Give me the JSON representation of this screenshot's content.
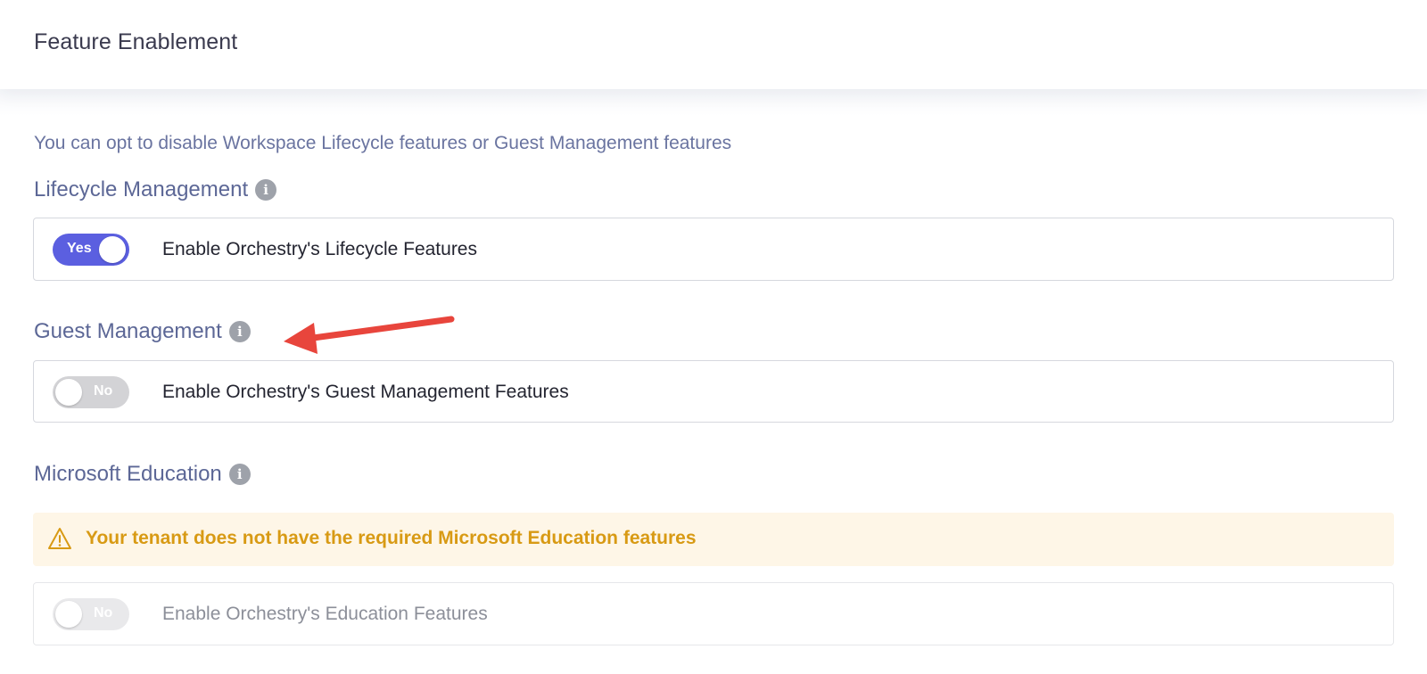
{
  "header": {
    "title": "Feature Enablement"
  },
  "intro_text": "You can opt to disable Workspace Lifecycle features or Guest Management features",
  "sections": [
    {
      "title": "Lifecycle Management",
      "icon": "info-icon",
      "toggle": {
        "state": "Yes",
        "enabled": true
      },
      "label": "Enable Orchestry's Lifecycle Features"
    },
    {
      "title": "Guest Management",
      "icon": "info-icon",
      "toggle": {
        "state": "No",
        "enabled": false
      },
      "label": "Enable Orchestry's Guest Management Features"
    },
    {
      "title": "Microsoft Education",
      "icon": "info-icon",
      "warning": {
        "icon": "warning-triangle-icon",
        "text": "Your tenant does not have the required Microsoft Education features"
      },
      "toggle": {
        "state": "No",
        "enabled": false,
        "disabled": true
      },
      "label": "Enable Orchestry's Education Features"
    }
  ],
  "annotation": {
    "icon": "red-arrow-icon",
    "color": "#e8453c"
  },
  "colors": {
    "toggle_on": "#5b5fe0",
    "toggle_off": "#d3d3d6",
    "section_title": "#5c6796",
    "warning_text": "#d89a14",
    "warning_bg": "#fef6e7"
  }
}
